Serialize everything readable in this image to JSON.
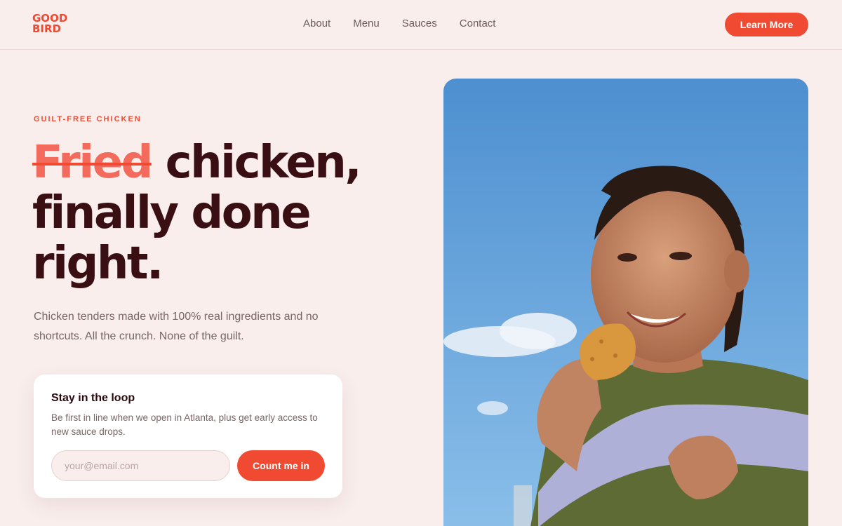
{
  "header": {
    "logo": {
      "line1": "GOOD",
      "line2": "BIRD"
    },
    "nav": [
      {
        "label": "About"
      },
      {
        "label": "Menu"
      },
      {
        "label": "Sauces"
      },
      {
        "label": "Contact"
      }
    ],
    "cta_label": "Learn More"
  },
  "hero": {
    "eyebrow": "GUILT-FREE CHICKEN",
    "headline_struck": "Fried",
    "headline_rest_1": " chicken,",
    "headline_line2": "finally done",
    "headline_line3": "right.",
    "subtext": "Chicken tenders made with 100% real ingredients and no shortcuts. All the crunch. None of the guilt."
  },
  "signup": {
    "title": "Stay in the loop",
    "description": "Be first in line when we open in Atlanta, plus get early access to new sauce drops.",
    "email_placeholder": "your@email.com",
    "email_value": "",
    "submit_label": "Count me in"
  },
  "colors": {
    "background": "#f9eeec",
    "accent": "#f04a32",
    "headline": "#3a0f14",
    "strike": "#f36b5c",
    "muted_text": "#7a6566"
  },
  "photo": {
    "icon": "woman-eating-chicken-tender-photo"
  }
}
